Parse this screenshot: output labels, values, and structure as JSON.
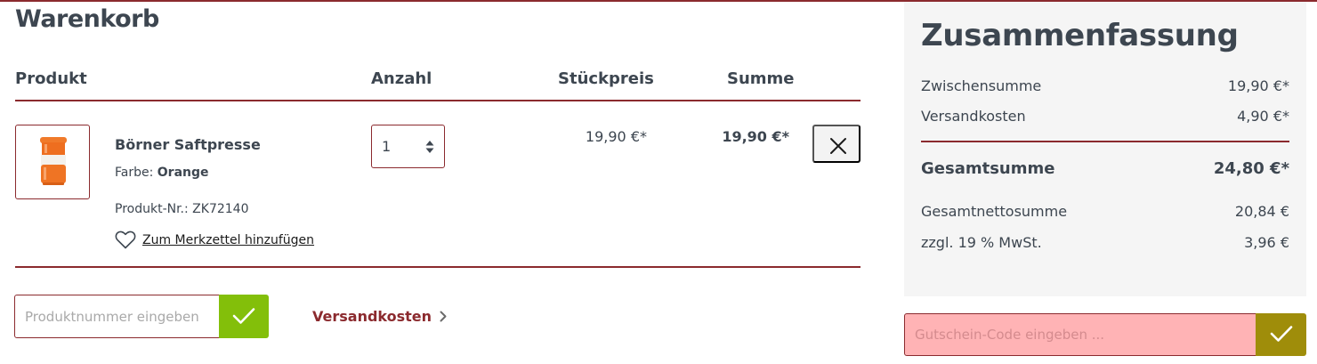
{
  "colors": {
    "accent": "#8b2a2e",
    "submit_green": "#83bf0a",
    "voucher_button": "#9f8d0a",
    "voucher_field": "#ffb3b5",
    "summary_bg": "#f5f5f5",
    "text": "#3d4650"
  },
  "cart": {
    "title": "Warenkorb",
    "columns": {
      "product": "Produkt",
      "quantity": "Anzahl",
      "unit_price": "Stückpreis",
      "total": "Summe"
    },
    "items": [
      {
        "name": "Börner Saftpresse",
        "color_label": "Farbe:",
        "color_value": "Orange",
        "product_number": "Produkt-Nr.: ZK72140",
        "wishlist_label": "Zum Merkzettel hinzufügen",
        "wishlist_icon": "heart-icon",
        "quantity": "1",
        "unit_price": "19,90 €*",
        "line_total": "19,90 €*",
        "remove_icon": "close-icon"
      }
    ]
  },
  "add_product": {
    "placeholder": "Produktnummer eingeben",
    "submit_icon": "checkmark-icon"
  },
  "shipping_link": {
    "label": "Versandkosten",
    "icon": "chevron-right-icon"
  },
  "summary": {
    "title": "Zusammenfassung",
    "subtotal_label": "Zwischensumme",
    "subtotal_value": "19,90 €*",
    "shipping_label": "Versandkosten",
    "shipping_value": "4,90 €*",
    "grand_total_label": "Gesamtsumme",
    "grand_total_value": "24,80 €*",
    "net_total_label": "Gesamtnettosumme",
    "net_total_value": "20,84 €",
    "vat_label": "zzgl. 19 % MwSt.",
    "vat_value": "3,96 €"
  },
  "voucher": {
    "placeholder": "Gutschein-Code eingeben ...",
    "submit_icon": "checkmark-icon"
  }
}
